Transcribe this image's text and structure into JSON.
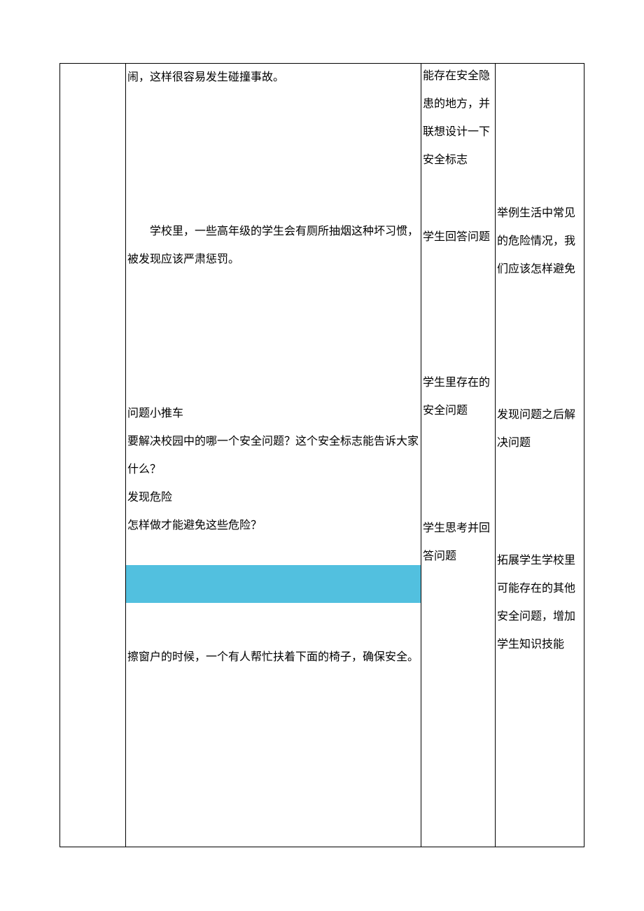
{
  "col2": {
    "p1": "闹，这样很容易发生碰撞事故。",
    "p2": "学校里，一些高年级的学生会有厕所抽烟这种坏习惯，被发现应该严肃惩罚。",
    "p3": "问题小推车",
    "p4": "要解决校园中的哪一个安全问题？这个安全标志能告诉大家什么？",
    "p5": "发现危险",
    "p6": "怎样做才能避免这些危险？",
    "p7": "擦窗户的时候，一个有人帮忙扶着下面的椅子，确保安全。"
  },
  "col3": {
    "t1": "能存在安全隐患的地方，并联想设计一下安全标志",
    "t2": "学生回答问题",
    "t3": "学生里存在的安全问题",
    "t4": "学生思考并回答问题"
  },
  "col4": {
    "t1": "举例生活中常见的危险情况，我们应该怎样避免",
    "t2": "发现问题之后解决问题",
    "t3": "拓展学生学校里可能存在的其他安全问题，增加学生知识技能"
  }
}
